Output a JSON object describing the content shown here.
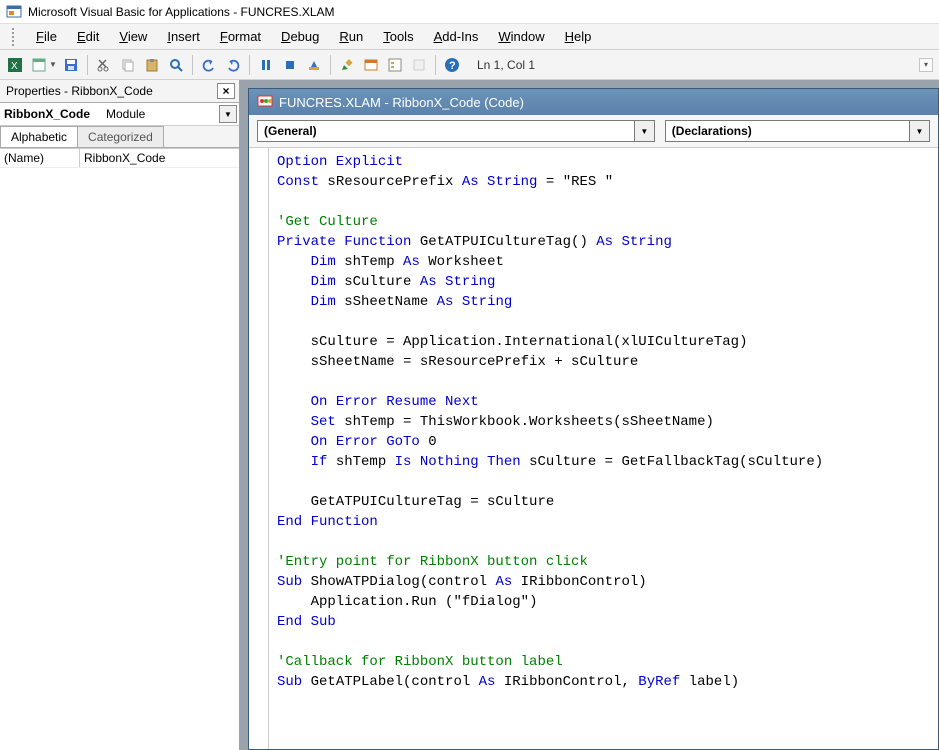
{
  "window": {
    "title": "Microsoft Visual Basic for Applications - FUNCRES.XLAM"
  },
  "menu": {
    "items": [
      "File",
      "Edit",
      "View",
      "Insert",
      "Format",
      "Debug",
      "Run",
      "Tools",
      "Add-Ins",
      "Window",
      "Help"
    ]
  },
  "toolbar": {
    "position": "Ln 1, Col 1"
  },
  "properties_pane": {
    "title": "Properties - RibbonX_Code",
    "object_name": "RibbonX_Code",
    "object_type": "Module",
    "tabs": {
      "alphabetic": "Alphabetic",
      "categorized": "Categorized"
    },
    "rows": [
      {
        "key": "(Name)",
        "value": "RibbonX_Code"
      }
    ]
  },
  "code_window": {
    "title": "FUNCRES.XLAM - RibbonX_Code (Code)",
    "combo_left": "(General)",
    "combo_right": "(Declarations)",
    "code_lines": [
      {
        "t": "plain",
        "segs": [
          {
            "c": "kw",
            "s": "Option Explicit"
          }
        ]
      },
      {
        "t": "plain",
        "segs": [
          {
            "c": "kw",
            "s": "Const"
          },
          {
            "c": "",
            "s": " sResourcePrefix "
          },
          {
            "c": "kw",
            "s": "As String"
          },
          {
            "c": "",
            "s": " = "
          },
          {
            "c": "str",
            "s": "\"RES \""
          }
        ]
      },
      {
        "t": "blank"
      },
      {
        "t": "plain",
        "segs": [
          {
            "c": "cm",
            "s": "'Get Culture"
          }
        ]
      },
      {
        "t": "plain",
        "segs": [
          {
            "c": "kw",
            "s": "Private Function"
          },
          {
            "c": "",
            "s": " GetATPUICultureTag() "
          },
          {
            "c": "kw",
            "s": "As String"
          }
        ]
      },
      {
        "t": "indent1",
        "segs": [
          {
            "c": "kw",
            "s": "Dim"
          },
          {
            "c": "",
            "s": " shTemp "
          },
          {
            "c": "kw",
            "s": "As"
          },
          {
            "c": "",
            "s": " Worksheet"
          }
        ]
      },
      {
        "t": "indent1",
        "segs": [
          {
            "c": "kw",
            "s": "Dim"
          },
          {
            "c": "",
            "s": " sCulture "
          },
          {
            "c": "kw",
            "s": "As String"
          }
        ]
      },
      {
        "t": "indent1",
        "segs": [
          {
            "c": "kw",
            "s": "Dim"
          },
          {
            "c": "",
            "s": " sSheetName "
          },
          {
            "c": "kw",
            "s": "As String"
          }
        ]
      },
      {
        "t": "blank"
      },
      {
        "t": "indent1",
        "segs": [
          {
            "c": "",
            "s": "sCulture = Application.International(xlUICultureTag)"
          }
        ]
      },
      {
        "t": "indent1",
        "segs": [
          {
            "c": "",
            "s": "sSheetName = sResourcePrefix + sCulture"
          }
        ]
      },
      {
        "t": "blank"
      },
      {
        "t": "indent1",
        "segs": [
          {
            "c": "kw",
            "s": "On Error Resume Next"
          }
        ]
      },
      {
        "t": "indent1",
        "segs": [
          {
            "c": "kw",
            "s": "Set"
          },
          {
            "c": "",
            "s": " shTemp = ThisWorkbook.Worksheets(sSheetName)"
          }
        ]
      },
      {
        "t": "indent1",
        "segs": [
          {
            "c": "kw",
            "s": "On Error GoTo"
          },
          {
            "c": "",
            "s": " 0"
          }
        ]
      },
      {
        "t": "indent1",
        "segs": [
          {
            "c": "kw",
            "s": "If"
          },
          {
            "c": "",
            "s": " shTemp "
          },
          {
            "c": "kw",
            "s": "Is Nothing Then"
          },
          {
            "c": "",
            "s": " sCulture = GetFallbackTag(sCulture)"
          }
        ]
      },
      {
        "t": "blank"
      },
      {
        "t": "indent1",
        "segs": [
          {
            "c": "",
            "s": "GetATPUICultureTag = sCulture"
          }
        ]
      },
      {
        "t": "plain",
        "segs": [
          {
            "c": "kw",
            "s": "End Function"
          }
        ]
      },
      {
        "t": "blank"
      },
      {
        "t": "plain",
        "segs": [
          {
            "c": "cm",
            "s": "'Entry point for RibbonX button click"
          }
        ]
      },
      {
        "t": "plain",
        "segs": [
          {
            "c": "kw",
            "s": "Sub"
          },
          {
            "c": "",
            "s": " ShowATPDialog(control "
          },
          {
            "c": "kw",
            "s": "As"
          },
          {
            "c": "",
            "s": " IRibbonControl)"
          }
        ]
      },
      {
        "t": "indent1",
        "segs": [
          {
            "c": "",
            "s": "Application.Run ("
          },
          {
            "c": "str",
            "s": "\"fDialog\""
          },
          {
            "c": "",
            "s": ")"
          }
        ]
      },
      {
        "t": "plain",
        "segs": [
          {
            "c": "kw",
            "s": "End Sub"
          }
        ]
      },
      {
        "t": "blank"
      },
      {
        "t": "plain",
        "segs": [
          {
            "c": "cm",
            "s": "'Callback for RibbonX button label"
          }
        ]
      },
      {
        "t": "plain",
        "segs": [
          {
            "c": "kw",
            "s": "Sub"
          },
          {
            "c": "",
            "s": " GetATPLabel(control "
          },
          {
            "c": "kw",
            "s": "As"
          },
          {
            "c": "",
            "s": " IRibbonControl, "
          },
          {
            "c": "kw",
            "s": "ByRef"
          },
          {
            "c": "",
            "s": " label)"
          }
        ]
      }
    ]
  }
}
